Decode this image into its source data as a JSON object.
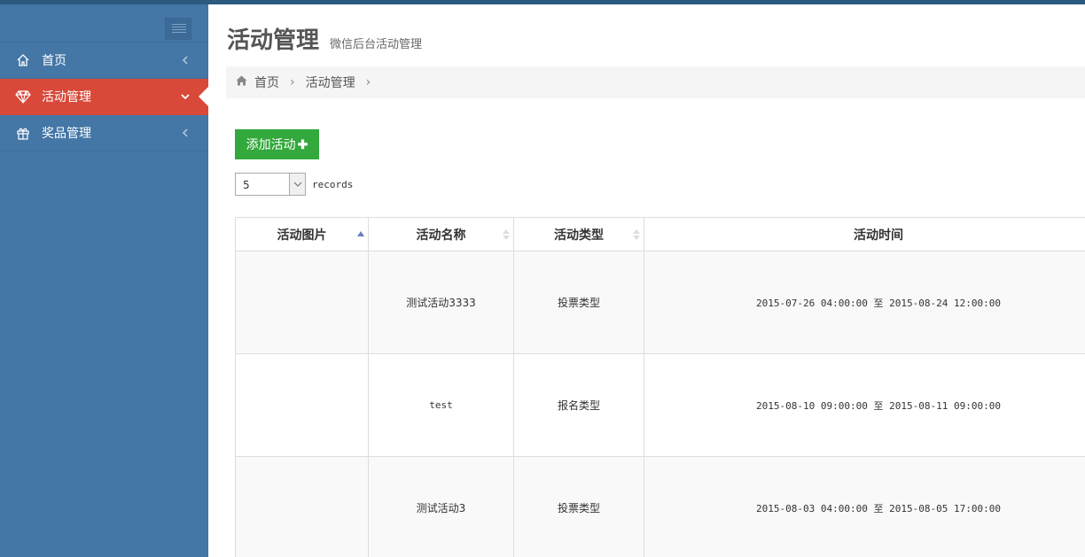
{
  "sidebar": {
    "items": [
      {
        "label": "首页",
        "icon": "home-icon"
      },
      {
        "label": "活动管理",
        "icon": "diamond-icon",
        "active": true
      },
      {
        "label": "奖品管理",
        "icon": "gift-icon"
      }
    ]
  },
  "header": {
    "title": "活动管理",
    "subtitle": "微信后台活动管理"
  },
  "breadcrumb": {
    "home": "首页",
    "current": "活动管理"
  },
  "toolbar": {
    "add_label": "添加活动"
  },
  "records": {
    "value": "5",
    "label": "records"
  },
  "table": {
    "columns": [
      "活动图片",
      "活动名称",
      "活动类型",
      "活动时间"
    ],
    "rows": [
      {
        "image": "",
        "name": "测试活动3333",
        "type": "投票类型",
        "time": "2015-07-26 04:00:00 至 2015-08-24 12:00:00"
      },
      {
        "image": "",
        "name": "test",
        "type": "报名类型",
        "time": "2015-08-10 09:00:00 至 2015-08-11 09:00:00"
      },
      {
        "image": "",
        "name": "测试活动3",
        "type": "投票类型",
        "time": "2015-08-03 04:00:00 至 2015-08-05 17:00:00"
      }
    ]
  },
  "colors": {
    "sidebar": "#4476a6",
    "active": "#d8493a",
    "add_button": "#33a83c"
  }
}
